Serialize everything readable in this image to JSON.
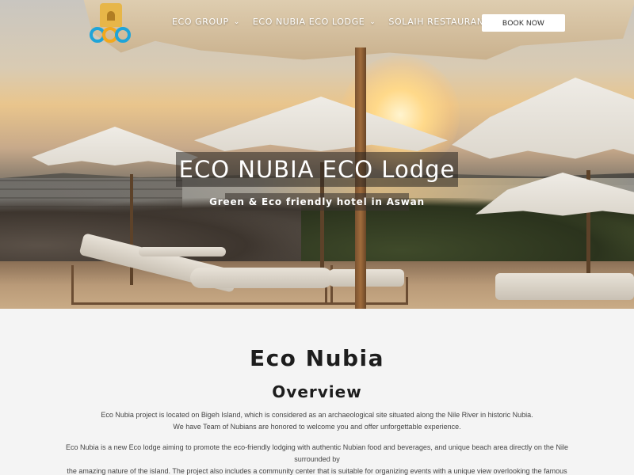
{
  "nav": {
    "items": [
      {
        "label": "ECO GROUP",
        "icon": "chevron-down-icon"
      },
      {
        "label": "ECO NUBIA ECO LODGE",
        "icon": "chevron-down-icon"
      },
      {
        "label": "SOLAIH RESTAURANT",
        "icon": "chevron-down-icon"
      }
    ],
    "book_label": "BOOK NOW",
    "logo_text": "eco"
  },
  "hero": {
    "title": "ECO NUBIA ECO Lodge",
    "subtitle": "Green & Eco friendly hotel in Aswan"
  },
  "content": {
    "title": "Eco Nubia",
    "subtitle": "Overview",
    "paragraph1_line1": "Eco Nubia project is located on Bigeh Island, which is considered as an archaeological site situated along the Nile River in historic Nubia.",
    "paragraph1_line2": "We have Team of Nubians are honored to welcome you and offer unforgettable experience.",
    "paragraph2_line1": "Eco Nubia is a new Eco lodge aiming to promote the eco-friendly lodging with authentic Nubian food and beverages, and unique beach area directly on the Nile surrounded by",
    "paragraph2_line2": "the amazing nature of the island. The project also includes a community center that is suitable for organizing events with a unique view overlooking the famous Philae temple."
  },
  "colors": {
    "logo_blue": "#1fa4d8",
    "logo_orange": "#f2a81d",
    "logo_gold": "#e7b648",
    "text_dark": "#1d1d1d",
    "page_bg": "#f4f4f4"
  }
}
